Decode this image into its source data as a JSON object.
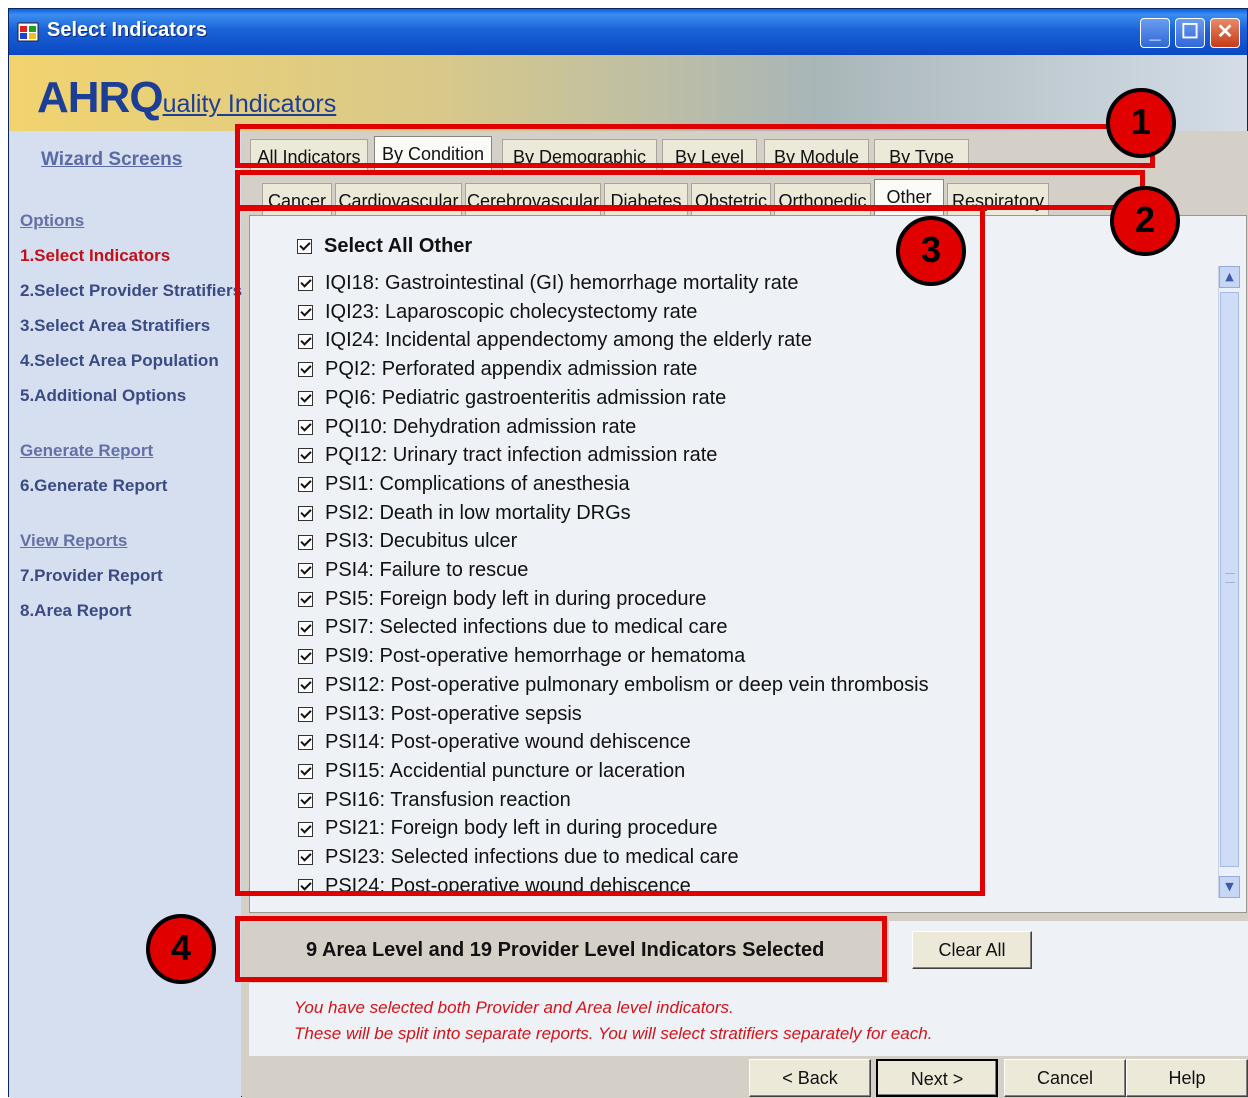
{
  "window": {
    "title": "Select Indicators"
  },
  "banner": {
    "logo_big": "AHRQ",
    "logo_small": "uality Indicators"
  },
  "sidebar": {
    "wizard_title": "Wizard Screens",
    "items": [
      {
        "label": "Options",
        "kind": "head"
      },
      {
        "label": "1.Select Indicators",
        "kind": "active"
      },
      {
        "label": "2.Select Provider Stratifiers",
        "kind": "step"
      },
      {
        "label": "3.Select Area Stratifiers",
        "kind": "step"
      },
      {
        "label": "4.Select Area Population",
        "kind": "step"
      },
      {
        "label": "5.Additional Options",
        "kind": "step"
      },
      {
        "label": "Generate Report",
        "kind": "head"
      },
      {
        "label": "6.Generate Report",
        "kind": "step"
      },
      {
        "label": "View Reports",
        "kind": "head"
      },
      {
        "label": "7.Provider Report",
        "kind": "step"
      },
      {
        "label": "8.Area Report",
        "kind": "step"
      }
    ]
  },
  "tabs_primary": [
    "All Indicators",
    "By Condition",
    "By Demographic",
    "By Level",
    "By Module",
    "By Type"
  ],
  "tabs_primary_selected": "By Condition",
  "tabs_secondary": [
    "Cancer",
    "Cardiovascular",
    "Cerebrovascular",
    "Diabetes",
    "Obstetric",
    "Orthopedic",
    "Other",
    "Respiratory"
  ],
  "tabs_secondary_selected": "Other",
  "select_all": {
    "label": "Select All Other",
    "checked": true
  },
  "indicators": [
    "IQI18: Gastrointestinal (GI) hemorrhage mortality rate",
    "IQI23: Laparoscopic cholecystectomy rate",
    "IQI24: Incidental appendectomy among the elderly rate",
    "PQI2: Perforated appendix admission rate",
    "PQI6: Pediatric gastroenteritis admission rate",
    "PQI10: Dehydration admission rate",
    "PQI12: Urinary tract infection admission rate",
    "PSI1: Complications of anesthesia",
    "PSI2: Death in low mortality DRGs",
    "PSI3: Decubitus ulcer",
    "PSI4: Failure to rescue",
    "PSI5: Foreign body left in during procedure",
    "PSI7: Selected infections due to medical care",
    "PSI9: Post-operative hemorrhage or hematoma",
    "PSI12: Post-operative pulmonary embolism or deep vein thrombosis",
    "PSI13: Post-operative sepsis",
    "PSI14: Post-operative wound dehiscence",
    "PSI15: Accidential puncture or laceration",
    "PSI16: Transfusion reaction",
    "PSI21: Foreign body left in during procedure",
    "PSI23: Selected infections due to medical care",
    "PSI24: Post-operative wound dehiscence"
  ],
  "summary": {
    "count_text": "9  Area Level and 19  Provider Level Indicators Selected",
    "clear_label": "Clear All",
    "note_line1": "You have selected both Provider and Area level indicators.",
    "note_line2": "These will be split into separate reports.  You will select stratifiers separately for each."
  },
  "nav": {
    "back": "< Back",
    "next": "Next >",
    "cancel": "Cancel",
    "help": "Help"
  },
  "callouts": [
    "1",
    "2",
    "3",
    "4"
  ],
  "colors": {
    "callout": "#e00000",
    "active_step": "#c0101a",
    "note": "#d4121a",
    "titlebar": "#0a48c4"
  }
}
